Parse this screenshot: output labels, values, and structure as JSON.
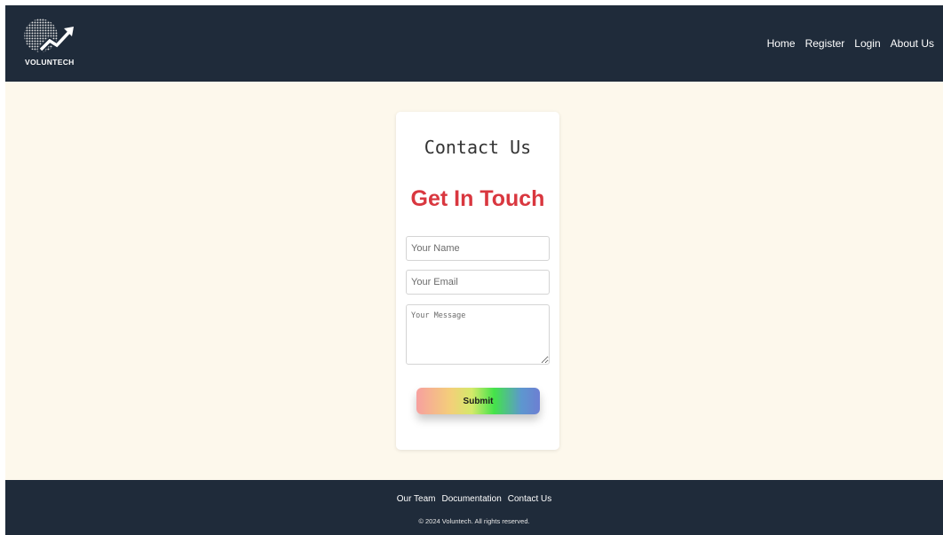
{
  "brand": {
    "logo_text": "VOLUNTECH",
    "icon": "globe-arrow-logo-icon"
  },
  "nav": {
    "items": [
      {
        "label": "Home"
      },
      {
        "label": "Register"
      },
      {
        "label": "Login"
      },
      {
        "label": "About Us"
      }
    ]
  },
  "contact": {
    "title": "Contact Us",
    "subtitle": "Get In Touch",
    "name_placeholder": "Your Name",
    "email_placeholder": "Your Email",
    "message_placeholder": "Your Message",
    "submit_label": "Submit"
  },
  "footer": {
    "links": [
      {
        "label": "Our Team"
      },
      {
        "label": "Documentation"
      },
      {
        "label": "Contact Us"
      }
    ],
    "copyright": "© 2024 Voluntech. All rights reserved."
  },
  "colors": {
    "navbar_bg": "#1f2b3a",
    "page_bg": "#fdf8ec",
    "accent_red": "#d9373f"
  }
}
